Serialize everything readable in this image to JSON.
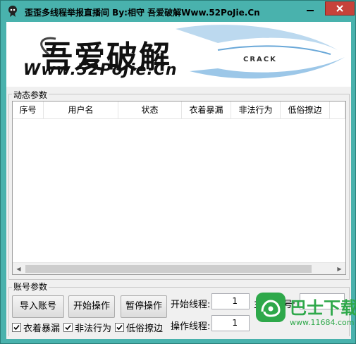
{
  "window": {
    "title": "歪歪多线程举报直播间      By:相守   吾爱破解Www.52PoJie.Cn"
  },
  "banner": {
    "logo_main": "吾爱破解",
    "logo_url": "Www.52PoJie.Cn",
    "logo_crack": "CRACK"
  },
  "dynamic_group": {
    "label": "动态参数",
    "columns": [
      "序号",
      "用户名",
      "状态",
      "衣着暴漏",
      "非法行为",
      "低俗撩边"
    ]
  },
  "account_group": {
    "label": "账号参数",
    "buttons": {
      "import": "导入账号",
      "start": "开始操作",
      "pause": "暂停操作"
    },
    "checkboxes": [
      {
        "label": "衣着暴漏",
        "checked": true
      },
      {
        "label": "非法行为",
        "checked": true
      },
      {
        "label": "低俗撩边",
        "checked": true
      }
    ],
    "start_threads_label": "开始线程:",
    "start_threads_value": "1",
    "op_threads_label": "操作线程:",
    "op_threads_value": "1",
    "anchor_label": "主播YY号:",
    "anchor_value": ""
  },
  "watermark": {
    "text": "巴士下载",
    "url": "www.11684.com"
  },
  "colors": {
    "titlebar": "#49b2ad",
    "close_button": "#c7423a",
    "watermark": "#2ea84a"
  }
}
